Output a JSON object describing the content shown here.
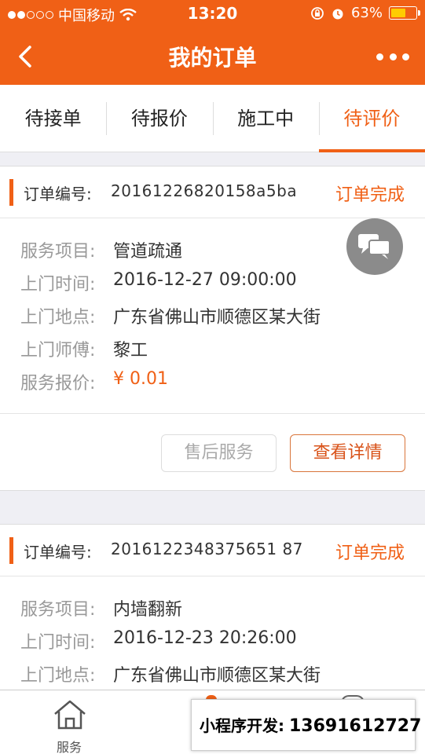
{
  "status_bar": {
    "carrier": "中国移动",
    "time": "13:20",
    "battery": "63%",
    "battery_level": 0.63,
    "signal_filled": 2,
    "signal_total": 5
  },
  "nav": {
    "title": "我的订单",
    "back_icon": "chevron-left-icon",
    "more_icon": "more-dots-icon"
  },
  "tabs": [
    {
      "label": "待接单",
      "active": false
    },
    {
      "label": "待报价",
      "active": false
    },
    {
      "label": "施工中",
      "active": false
    },
    {
      "label": "待评价",
      "active": true
    }
  ],
  "colors": {
    "accent": "#f06016",
    "text_muted": "#999999",
    "background": "#efeff4"
  },
  "orders": [
    {
      "order_label": "订单编号:",
      "order_no": "20161226820158a5ba",
      "status": "订单完成",
      "fields": [
        {
          "key": "服务项目:",
          "value": "管道疏通"
        },
        {
          "key": "上门时间:",
          "value": "2016-12-27 09:00:00"
        },
        {
          "key": "上门地点:",
          "value": "广东省佛山市顺德区某大街"
        },
        {
          "key": "上门师傅:",
          "value": "黎工"
        },
        {
          "key": "服务报价:",
          "value": "¥ 0.01"
        }
      ],
      "buttons": {
        "after_sales": "售后服务",
        "details": "查看详情"
      }
    },
    {
      "order_label": "订单编号:",
      "order_no": "2016122348375651 87",
      "status": "订单完成",
      "fields": [
        {
          "key": "服务项目:",
          "value": "内墙翻新"
        },
        {
          "key": "上门时间:",
          "value": "2016-12-23 20:26:00"
        },
        {
          "key": "上门地点:",
          "value": "广东省佛山市顺德区某大街"
        }
      ]
    }
  ],
  "bottom_bar": {
    "home_label": "服务",
    "home_icon": "home-icon"
  },
  "watermark": {
    "label": "小程序开发:",
    "phone": "13691612727"
  }
}
